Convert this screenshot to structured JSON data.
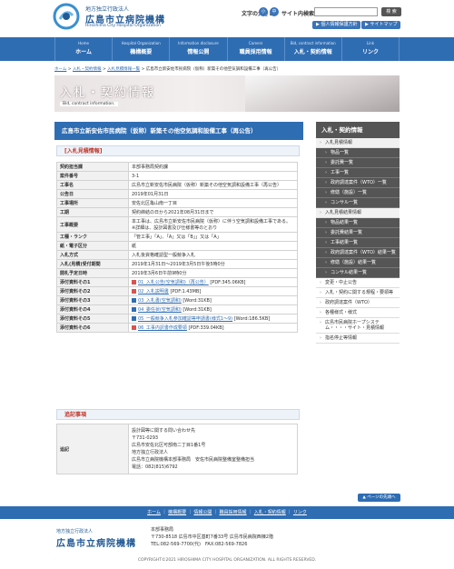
{
  "header": {
    "logo_small": "地方独立行政法人",
    "logo_main": "広島市立病院機構",
    "logo_en": "Hiroshima City Hospital Organization",
    "font_size_label": "文字の大きさ",
    "font_sizes": [
      "小",
      "中",
      "大"
    ],
    "search_label": "サイト内検索",
    "search_value": "",
    "search_button": "検 索",
    "privacy_button": "個人情報保護方針",
    "sitemap_button": "サイトマップ"
  },
  "nav": [
    {
      "en": "Home",
      "jp": "ホーム"
    },
    {
      "en": "Hospital Organization",
      "jp": "機構概要"
    },
    {
      "en": "Information disclosure",
      "jp": "情報公開"
    },
    {
      "en": "Careers",
      "jp": "職員採用情報"
    },
    {
      "en": "Bid, contract information",
      "jp": "入札・契約情報"
    },
    {
      "en": "Link",
      "jp": "リンク"
    }
  ],
  "breadcrumb": {
    "items": [
      "ホーム",
      "入札・契約情報",
      "入札見積情報一覧"
    ],
    "current": "広島市立新安佐市民病院（仮称）新築その他空気調和設備工事（再公告）",
    "sep": " > "
  },
  "banner": {
    "title": "入札・契約情報",
    "subtitle": "Bid, contract information."
  },
  "page_title": "広島市立新安佐市民病院（仮称）新築その他空気調和設備工事（再公告）",
  "section1": "[入札見積情報]",
  "rows": [
    {
      "h": "契約担当課",
      "v": "本部事務局契約課"
    },
    {
      "h": "案件番号",
      "v": "3-1"
    },
    {
      "h": "工事名",
      "v": "広島市立新安佐市民病院（仮称）新築その他空気調和設備工事（再公告）"
    },
    {
      "h": "公告日",
      "v": "2019年01月31日"
    },
    {
      "h": "工事場所",
      "v": "安佐北区亀山南一丁目"
    },
    {
      "h": "工期",
      "v": "契約締結の日から2021年08月31日まで"
    },
    {
      "h": "工事概要",
      "v": "本工事は、広島市立新安佐市民病院（仮称）に伴う空気調和設備工事である。　※詳細は、設計図書及び仕様書等のとおり"
    },
    {
      "h": "工種・ランク",
      "v": "「管工事」「A」、「A」又は「B」」又は「A」"
    },
    {
      "h": "紙・電子区分",
      "v": "紙"
    },
    {
      "h": "入札方式",
      "v": "入札後資格確認型一般競争入札"
    },
    {
      "h": "入札(見積)受付期間",
      "v": "2019年1月31日～2019年3月5日午後5時0分"
    },
    {
      "h": "開札予定日時",
      "v": "2019年3月6日午前9時0分"
    }
  ],
  "files": [
    {
      "h": "添付資料その1",
      "link": "01_入札公告(空気調和)（再公告）",
      "info": "[PDF:345.06KB]"
    },
    {
      "h": "添付資料その2",
      "link": "02_入札説明書",
      "info": "[PDF:1.43MB]"
    },
    {
      "h": "添付資料その3",
      "link": "03_入札書(空気調和)",
      "info": "[Word:31KB]"
    },
    {
      "h": "添付資料その4",
      "link": "04_委任状(空気調和)",
      "info": "[Word:31KB]"
    },
    {
      "h": "添付資料その5",
      "link": "05_一般競争入札参加確認等申請書(様式1～9)",
      "info": "[Word:186.5KB]"
    },
    {
      "h": "添付資料その6",
      "link": "06_工事内訳書作成要領",
      "info": "[PDF:339.04KB]"
    }
  ],
  "section2": "追記事項",
  "note": {
    "h": "追記",
    "lines": [
      "設計図等に関する問い合わせ先",
      "〒731-0293",
      "広島市安佐北区可部南二丁目1番1号",
      "地方独立行政法人",
      "広島市立病院機構本部事務局　安佐市民病院整備室整備担当",
      "電話：082(815)6792"
    ]
  },
  "sidebar": {
    "title": "入札・契約情報",
    "items": [
      {
        "label": "入札見積情報",
        "kind": "top"
      },
      {
        "label": "物品一覧",
        "kind": "sub"
      },
      {
        "label": "委託費一覧",
        "kind": "sub"
      },
      {
        "label": "工事一覧",
        "kind": "sub"
      },
      {
        "label": "政府調達案件（WTO）一覧",
        "kind": "sub"
      },
      {
        "label": "修繕（施設）一覧",
        "kind": "sub"
      },
      {
        "label": "コンサル一覧",
        "kind": "sub"
      },
      {
        "label": "入札見積結果情報",
        "kind": "top"
      },
      {
        "label": "物品結果一覧",
        "kind": "sub"
      },
      {
        "label": "委託費結果一覧",
        "kind": "sub"
      },
      {
        "label": "工事結果一覧",
        "kind": "sub"
      },
      {
        "label": "政府調達案件（WTO）結果一覧",
        "kind": "sub"
      },
      {
        "label": "修繕（施設）結果一覧",
        "kind": "sub"
      },
      {
        "label": "コンサル結果一覧",
        "kind": "sub"
      },
      {
        "label": "変更・中止公告",
        "kind": "plain"
      },
      {
        "label": "入札・契約に関する規程・要領等",
        "kind": "plain"
      },
      {
        "label": "政府調達案件（WTO）",
        "kind": "plain"
      },
      {
        "label": "各種様式・様式",
        "kind": "plain"
      },
      {
        "label": "広島市民病院ホープシステム・・・・サイト・見積情報",
        "kind": "plain"
      },
      {
        "label": "指名停止等情報",
        "kind": "plain"
      }
    ]
  },
  "page_top": "▲ ページの先頭へ",
  "footer": {
    "links": [
      "ホーム",
      "機構概要",
      "情報公開",
      "職員採用情報",
      "入札・契約情報",
      "リンク"
    ],
    "logo_small": "地方独立行政法人",
    "logo_main": "広島市立病院機構",
    "office": "本部事務局",
    "address": "〒730-8518 広島市中区基町7番33号 広島市民病院西棟2階",
    "tel": "TEL:082-569-7700(代)　FAX:082-569-7826",
    "copyright": "COPYRIGHT©2021 HIROSHIMA CITY HOSPITAL ORGANIZATION. ALL RIGHTS RESERVED."
  },
  "colors": {
    "primary": "#2f6db3",
    "sidebar_dark": "#555555",
    "accent_red": "#c0392b"
  }
}
